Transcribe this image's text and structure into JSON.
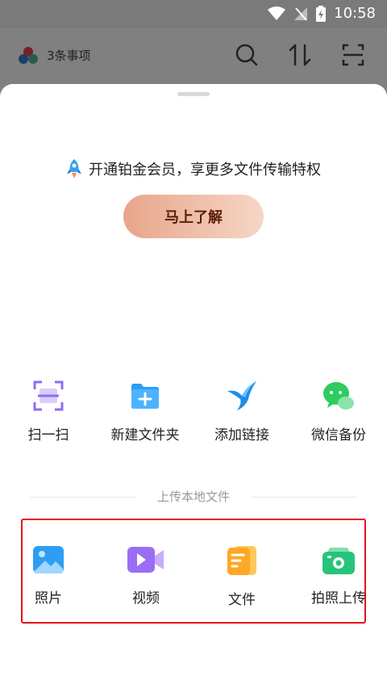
{
  "status_bar": {
    "time": "10:58"
  },
  "header": {
    "title": "3条事项"
  },
  "promo": {
    "text": "开通铂金会员，享更多文件传输特权",
    "button_label": "马上了解"
  },
  "tools": [
    {
      "label": "扫一扫",
      "icon": "scan-icon"
    },
    {
      "label": "新建文件夹",
      "icon": "new-folder-icon"
    },
    {
      "label": "添加链接",
      "icon": "bird-link-icon"
    },
    {
      "label": "微信备份",
      "icon": "wechat-icon"
    }
  ],
  "upload_section": {
    "title": "上传本地文件",
    "items": [
      {
        "label": "照片",
        "icon": "photo-icon"
      },
      {
        "label": "视频",
        "icon": "video-icon"
      },
      {
        "label": "文件",
        "icon": "file-icon"
      },
      {
        "label": "拍照上传",
        "icon": "camera-icon"
      }
    ]
  },
  "colors": {
    "accent_red": "#e5131d",
    "promo_text": "#5a1d0a"
  }
}
